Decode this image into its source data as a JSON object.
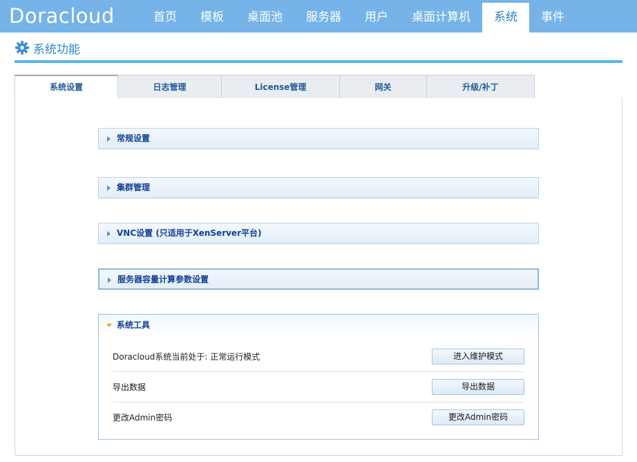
{
  "app": {
    "logo": "Doracloud"
  },
  "nav": {
    "items": [
      {
        "label": "首页"
      },
      {
        "label": "模板"
      },
      {
        "label": "桌面池"
      },
      {
        "label": "服务器"
      },
      {
        "label": "用户"
      },
      {
        "label": "桌面计算机"
      },
      {
        "label": "系统",
        "active": true
      },
      {
        "label": "事件"
      }
    ]
  },
  "page": {
    "title": "系统功能",
    "icon": "gear-icon",
    "accent": "#4fb7ee"
  },
  "tabs": [
    {
      "label": "系统设置",
      "active": true
    },
    {
      "label": "日志管理"
    },
    {
      "label": "License管理"
    },
    {
      "label": "网关"
    },
    {
      "label": "升级/补丁"
    }
  ],
  "sections": [
    {
      "label": "常规设置",
      "expanded": false
    },
    {
      "label": "集群管理",
      "expanded": false
    },
    {
      "label": "VNC设置 (只适用于XenServer平台)",
      "expanded": false
    },
    {
      "label": "服务器容量计算参数设置",
      "expanded": false
    }
  ],
  "tools": {
    "label": "系统工具",
    "expanded": true,
    "rows": [
      {
        "desc": "Doracloud系统当前处于: 正常运行模式",
        "button": "进入维护模式"
      },
      {
        "desc": "导出数据",
        "button": "导出数据"
      },
      {
        "desc": "更改Admin密码",
        "button": "更改Admin密码"
      }
    ]
  }
}
